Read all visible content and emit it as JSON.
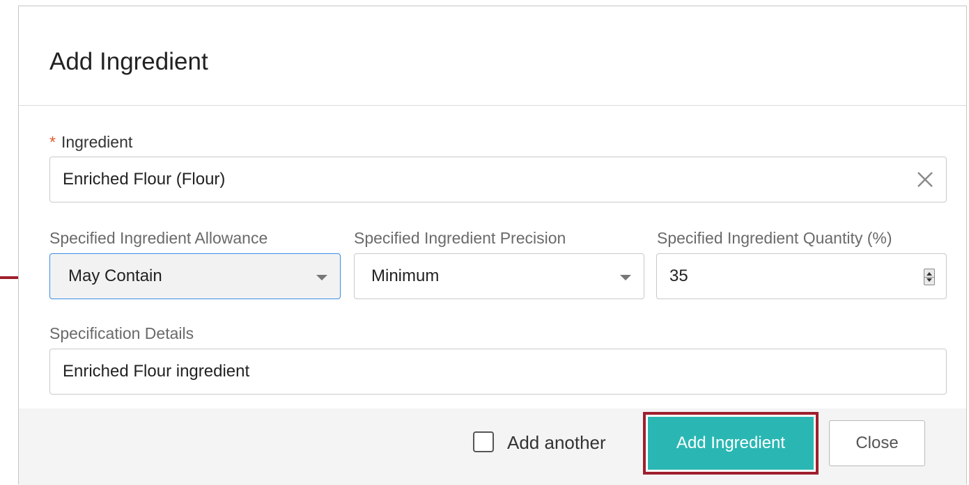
{
  "dialog": {
    "title": "Add Ingredient"
  },
  "ingredient": {
    "required_mark": "*",
    "label": "Ingredient",
    "value": "Enriched Flour (Flour)"
  },
  "allowance": {
    "label": "Specified Ingredient Allowance",
    "value": "May Contain"
  },
  "precision": {
    "label": "Specified Ingredient Precision",
    "value": "Minimum"
  },
  "quantity": {
    "label": "Specified Ingredient Quantity (%)",
    "value": "35"
  },
  "details": {
    "label": "Specification Details",
    "value": "Enriched Flour ingredient"
  },
  "footer": {
    "add_another_label": "Add another",
    "add_another_checked": false,
    "add_button_label": "Add Ingredient",
    "close_button_label": "Close"
  },
  "icons": {
    "clear": "close-x-icon",
    "dropdown": "caret-down-icon",
    "spinner": "number-spinner-icon",
    "annotation": "red-arrow-icon"
  },
  "colors": {
    "primary_button": "#2ab7b3",
    "highlight_border": "#9e1f2d",
    "required_mark": "#e05a2a",
    "focus_border": "#3a8ee6",
    "annotation_arrow": "#9e1f2d"
  }
}
